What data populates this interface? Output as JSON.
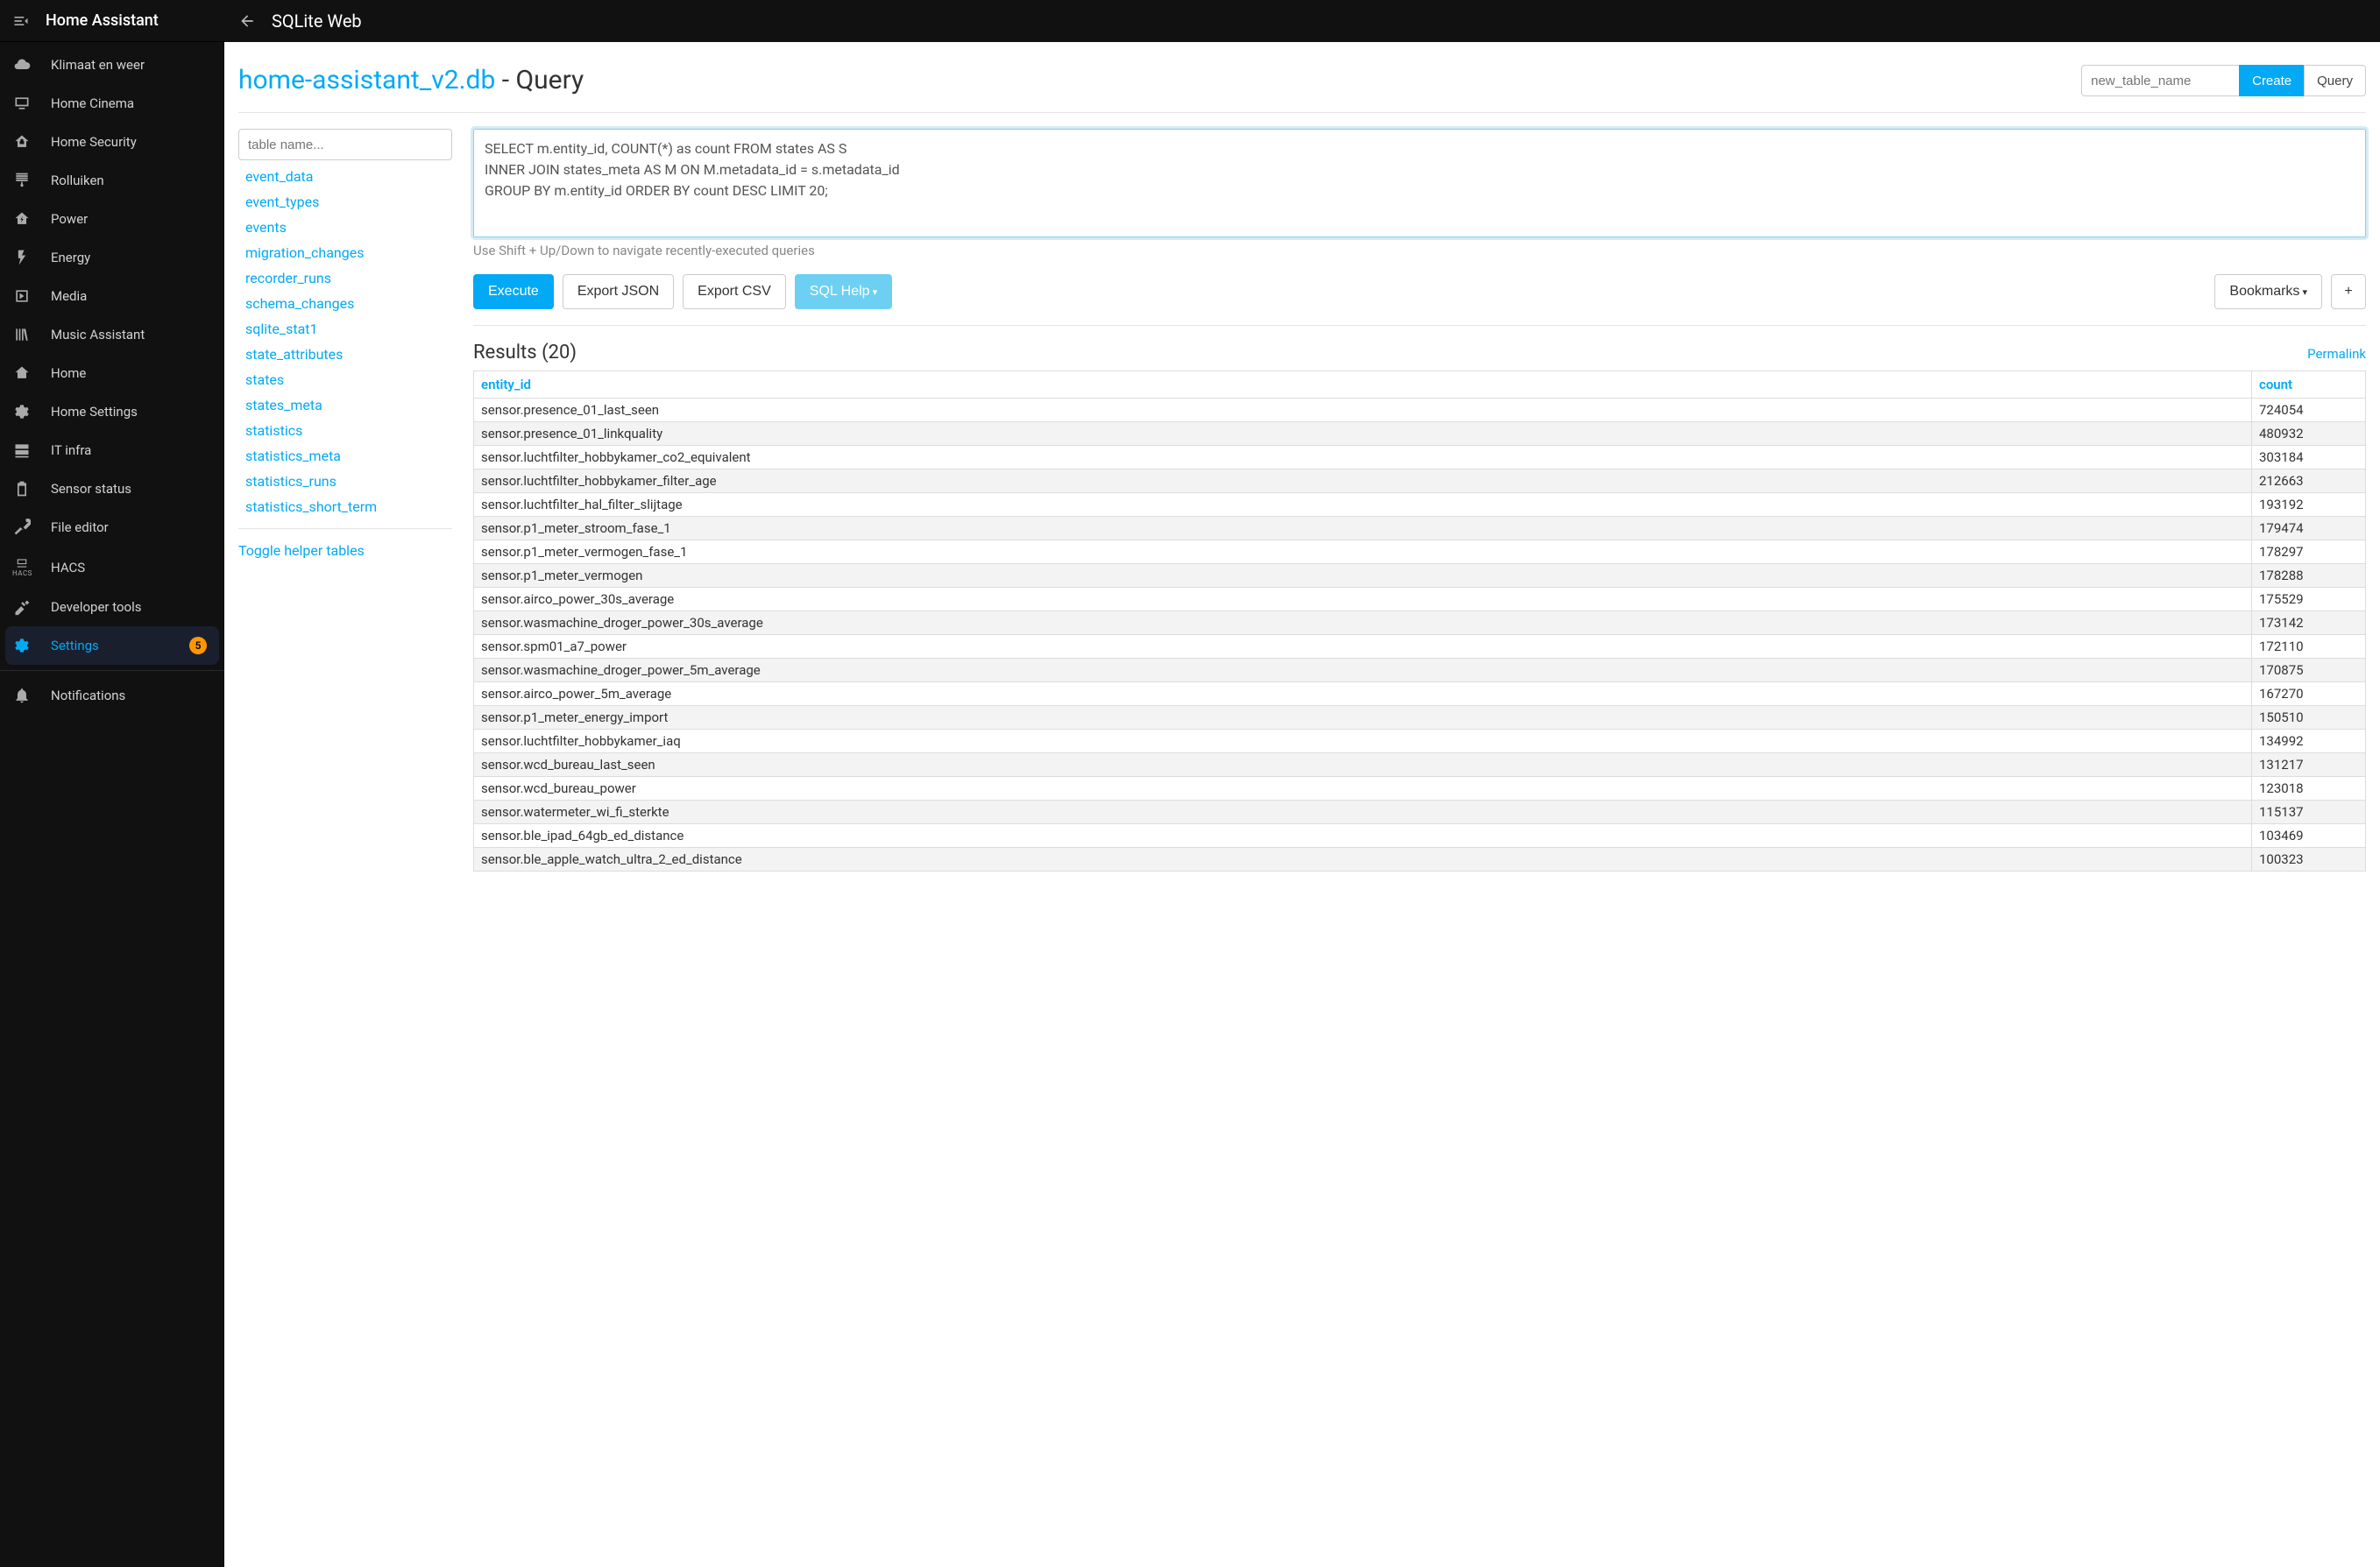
{
  "app_title": "Home Assistant",
  "topbar": {
    "title": "SQLite Web"
  },
  "sidebar": {
    "items": [
      {
        "label": "Klimaat en weer",
        "icon": "cloud-icon"
      },
      {
        "label": "Home Cinema",
        "icon": "screen-icon"
      },
      {
        "label": "Home Security",
        "icon": "home-lock-icon"
      },
      {
        "label": "Rolluiken",
        "icon": "blinds-icon"
      },
      {
        "label": "Power",
        "icon": "home-bolt-icon"
      },
      {
        "label": "Energy",
        "icon": "flash-icon"
      },
      {
        "label": "Media",
        "icon": "play-box-icon"
      },
      {
        "label": "Music Assistant",
        "icon": "library-icon"
      },
      {
        "label": "Home",
        "icon": "home-snow-icon"
      },
      {
        "label": "Home Settings",
        "icon": "cog-icon"
      },
      {
        "label": "IT infra",
        "icon": "server-icon"
      },
      {
        "label": "Sensor status",
        "icon": "battery-icon"
      },
      {
        "label": "File editor",
        "icon": "wrench-icon"
      },
      {
        "label": "HACS",
        "icon": "hacs-icon"
      },
      {
        "label": "Developer tools",
        "icon": "hammer-icon"
      },
      {
        "label": "Settings",
        "icon": "cog-icon",
        "active": true,
        "badge": "5"
      }
    ],
    "notifications_label": "Notifications"
  },
  "page": {
    "db_name": "home-assistant_v2.db",
    "title_suffix": " - Query",
    "new_table_placeholder": "new_table_name",
    "create_label": "Create",
    "query_label": "Query"
  },
  "table_list": {
    "filter_placeholder": "table name...",
    "tables": [
      "event_data",
      "event_types",
      "events",
      "migration_changes",
      "recorder_runs",
      "schema_changes",
      "sqlite_stat1",
      "state_attributes",
      "states",
      "states_meta",
      "statistics",
      "statistics_meta",
      "statistics_runs",
      "statistics_short_term"
    ],
    "toggle_label": "Toggle helper tables"
  },
  "query": {
    "sql": "SELECT m.entity_id, COUNT(*) as count FROM states AS S\nINNER JOIN states_meta AS M ON M.metadata_id = s.metadata_id\nGROUP BY m.entity_id ORDER BY count DESC LIMIT 20;",
    "hint": "Use Shift + Up/Down to navigate recently-executed queries",
    "buttons": {
      "execute": "Execute",
      "export_json": "Export JSON",
      "export_csv": "Export CSV",
      "sql_help": "SQL Help",
      "bookmarks": "Bookmarks",
      "add": "+"
    }
  },
  "results": {
    "title": "Results (20)",
    "permalink": "Permalink",
    "columns": [
      "entity_id",
      "count"
    ],
    "rows": [
      [
        "sensor.presence_01_last_seen",
        "724054"
      ],
      [
        "sensor.presence_01_linkquality",
        "480932"
      ],
      [
        "sensor.luchtfilter_hobbykamer_co2_equivalent",
        "303184"
      ],
      [
        "sensor.luchtfilter_hobbykamer_filter_age",
        "212663"
      ],
      [
        "sensor.luchtfilter_hal_filter_slijtage",
        "193192"
      ],
      [
        "sensor.p1_meter_stroom_fase_1",
        "179474"
      ],
      [
        "sensor.p1_meter_vermogen_fase_1",
        "178297"
      ],
      [
        "sensor.p1_meter_vermogen",
        "178288"
      ],
      [
        "sensor.airco_power_30s_average",
        "175529"
      ],
      [
        "sensor.wasmachine_droger_power_30s_average",
        "173142"
      ],
      [
        "sensor.spm01_a7_power",
        "172110"
      ],
      [
        "sensor.wasmachine_droger_power_5m_average",
        "170875"
      ],
      [
        "sensor.airco_power_5m_average",
        "167270"
      ],
      [
        "sensor.p1_meter_energy_import",
        "150510"
      ],
      [
        "sensor.luchtfilter_hobbykamer_iaq",
        "134992"
      ],
      [
        "sensor.wcd_bureau_last_seen",
        "131217"
      ],
      [
        "sensor.wcd_bureau_power",
        "123018"
      ],
      [
        "sensor.watermeter_wi_fi_sterkte",
        "115137"
      ],
      [
        "sensor.ble_ipad_64gb_ed_distance",
        "103469"
      ],
      [
        "sensor.ble_apple_watch_ultra_2_ed_distance",
        "100323"
      ]
    ]
  }
}
